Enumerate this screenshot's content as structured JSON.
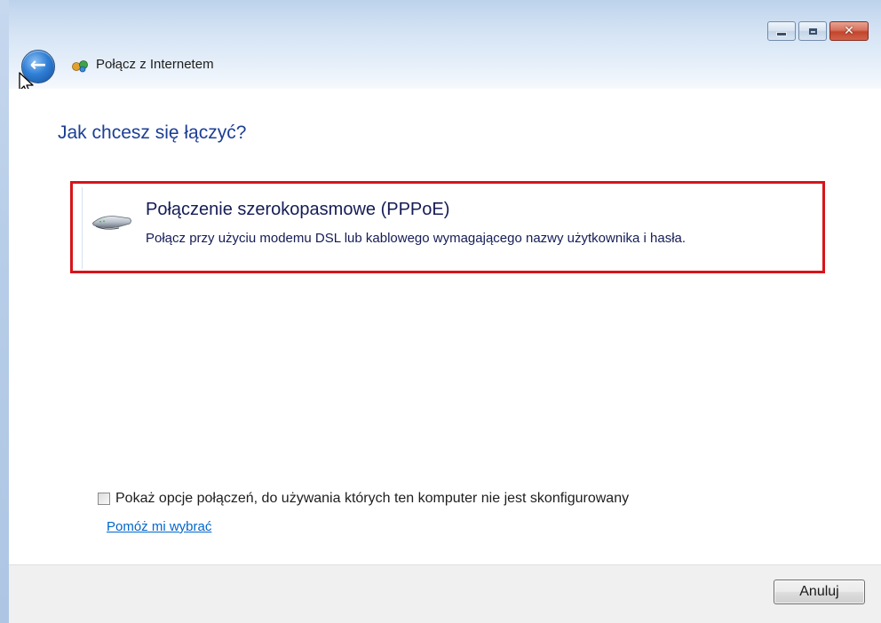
{
  "window": {
    "app_title": "Połącz z Internetem",
    "caption_buttons": {
      "minimize": "minimize-icon",
      "maximize": "maximize-icon",
      "close": "close-icon"
    }
  },
  "header": {
    "back_icon": "back-arrow-icon",
    "app_icon": "network-connection-icon"
  },
  "main": {
    "heading": "Jak chcesz się łączyć?",
    "option": {
      "icon": "modem-icon",
      "title": "Połączenie szerokopasmowe (PPPoE)",
      "description": "Połącz przy użyciu modemu DSL lub kablowego wymagającego nazwy użytkownika i hasła."
    },
    "show_options_checkbox": {
      "label": "Pokaż opcje połączeń, do używania których ten komputer nie jest skonfigurowany",
      "checked": false
    },
    "help_link": "Pomóż mi wybrać"
  },
  "footer": {
    "cancel_label": "Anuluj"
  },
  "colors": {
    "heading": "#1c3f94",
    "highlight_border": "#d7141a",
    "link": "#0066cc"
  }
}
